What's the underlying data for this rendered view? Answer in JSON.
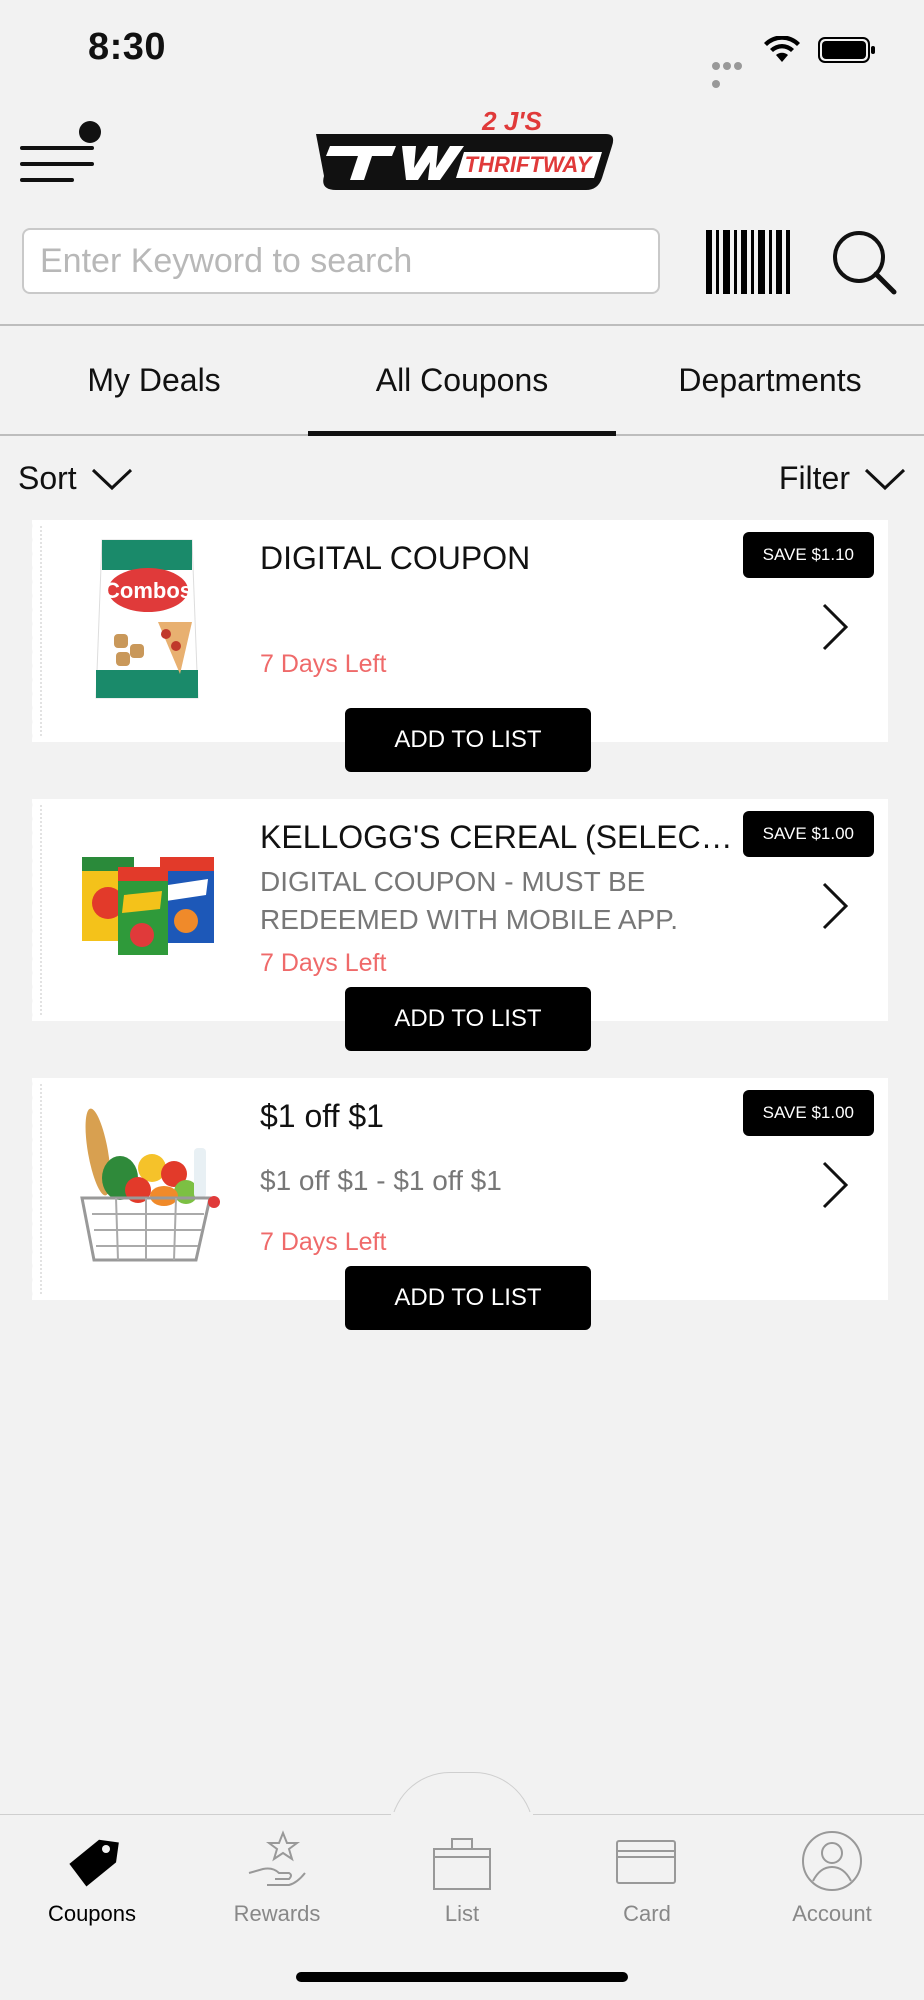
{
  "status_bar": {
    "time": "8:30"
  },
  "header": {
    "logo_text_top": "2 J'S",
    "logo_text_bottom": "THRIFTWAY",
    "brand_red": "#e03a3a"
  },
  "search": {
    "placeholder": "Enter Keyword to search",
    "value": ""
  },
  "tabs": [
    {
      "label": "My Deals",
      "active": false
    },
    {
      "label": "All Coupons",
      "active": true
    },
    {
      "label": "Departments",
      "active": false
    }
  ],
  "sort": {
    "label": "Sort"
  },
  "filter": {
    "label": "Filter"
  },
  "coupons": [
    {
      "title": "DIGITAL COUPON",
      "description": "",
      "days_left": "7 Days Left",
      "save": "SAVE $1.10",
      "button": "ADD TO LIST",
      "image": "combos-snack-bag",
      "image_text": "Combos"
    },
    {
      "title": "KELLOGG'S CEREAL (SELECTED VARIETIES)",
      "description": "DIGITAL COUPON - MUST BE REDEEMED WITH MOBILE APP.",
      "days_left": "7 Days Left",
      "save": "SAVE $1.00",
      "button": "ADD TO LIST",
      "image": "kelloggs-cereal-boxes"
    },
    {
      "title": "$1 off $1",
      "description": "$1 off $1 - $1 off $1",
      "days_left": "7 Days Left",
      "save": "SAVE $1.00",
      "button": "ADD TO LIST",
      "image": "grocery-basket"
    }
  ],
  "bottom_nav": [
    {
      "label": "Coupons",
      "icon": "tag-icon",
      "active": true
    },
    {
      "label": "Rewards",
      "icon": "rewards-hand-star-icon",
      "active": false
    },
    {
      "label": "List",
      "icon": "shopping-bag-icon",
      "active": false
    },
    {
      "label": "Card",
      "icon": "card-icon",
      "active": false
    },
    {
      "label": "Account",
      "icon": "account-icon",
      "active": false
    }
  ],
  "colors": {
    "accent": "#000000",
    "days_left": "#ef6a6a",
    "background": "#f2f2f2"
  }
}
